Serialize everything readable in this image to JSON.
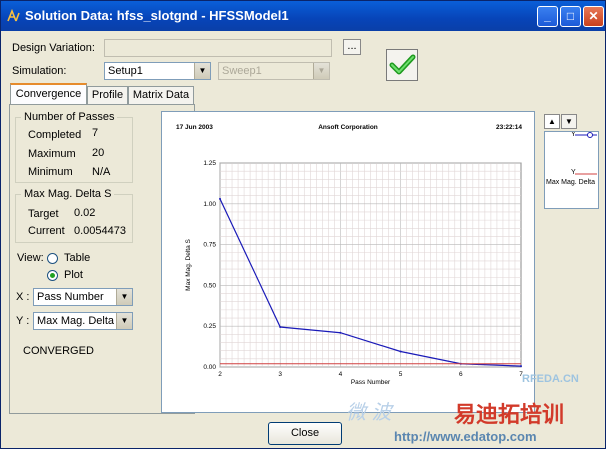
{
  "window": {
    "title": "Solution Data: hfss_slotgnd - HFSSModel1"
  },
  "form": {
    "design_variation_label": "Design Variation:",
    "design_variation_value": "",
    "browse_label": "...",
    "simulation_label": "Simulation:",
    "setup_value": "Setup1",
    "sweep_value": "Sweep1"
  },
  "tabs": [
    "Convergence",
    "Profile",
    "Matrix Data"
  ],
  "passes": {
    "group_label": "Number of Passes",
    "completed_label": "Completed",
    "completed_value": "7",
    "maximum_label": "Maximum",
    "maximum_value": "20",
    "minimum_label": "Minimum",
    "minimum_value": "N/A"
  },
  "delta": {
    "group_label": "Max Mag. Delta S",
    "target_label": "Target",
    "target_value": "0.02",
    "current_label": "Current",
    "current_value": "0.0054473"
  },
  "view": {
    "label": "View:",
    "table_label": "Table",
    "plot_label": "Plot",
    "selected": "Plot"
  },
  "axes": {
    "x_label": "X :",
    "x_value": "Pass Number",
    "y_label": "Y :",
    "y_value": "Max Mag. Delta"
  },
  "status": "CONVERGED",
  "plot_header": {
    "date": "17 Jun 2003",
    "company": "Ansoft Corporation",
    "time": "23:22:14"
  },
  "legend": {
    "item1": "Y",
    "item2": "Y",
    "item2_label": "Max Mag. Delta"
  },
  "buttons": {
    "close": "Close"
  },
  "watermarks": [
    "RFEDA.CN",
    "微 波",
    "易迪拓培训",
    "http://www.edatop.com"
  ],
  "colors": {
    "line": "#1a1ab8",
    "target": "#d04040"
  },
  "chart_data": {
    "type": "line",
    "title": "",
    "xlabel": "Pass Number",
    "ylabel": "Max Mag. Delta S",
    "xlim": [
      2,
      7
    ],
    "ylim": [
      0,
      1.25
    ],
    "x_ticks": [
      "2",
      "3",
      "4",
      "5",
      "6",
      "7"
    ],
    "y_ticks": [
      "0.00",
      "0.25",
      "0.50",
      "0.75",
      "1.00",
      "1.25"
    ],
    "series": [
      {
        "x": [
          2,
          3,
          4,
          5,
          6,
          7
        ],
        "values": [
          1.03,
          0.245,
          0.21,
          0.095,
          0.02,
          0.0054
        ]
      },
      {
        "x": [
          2,
          7
        ],
        "values": [
          0.02,
          0.02
        ]
      }
    ]
  }
}
